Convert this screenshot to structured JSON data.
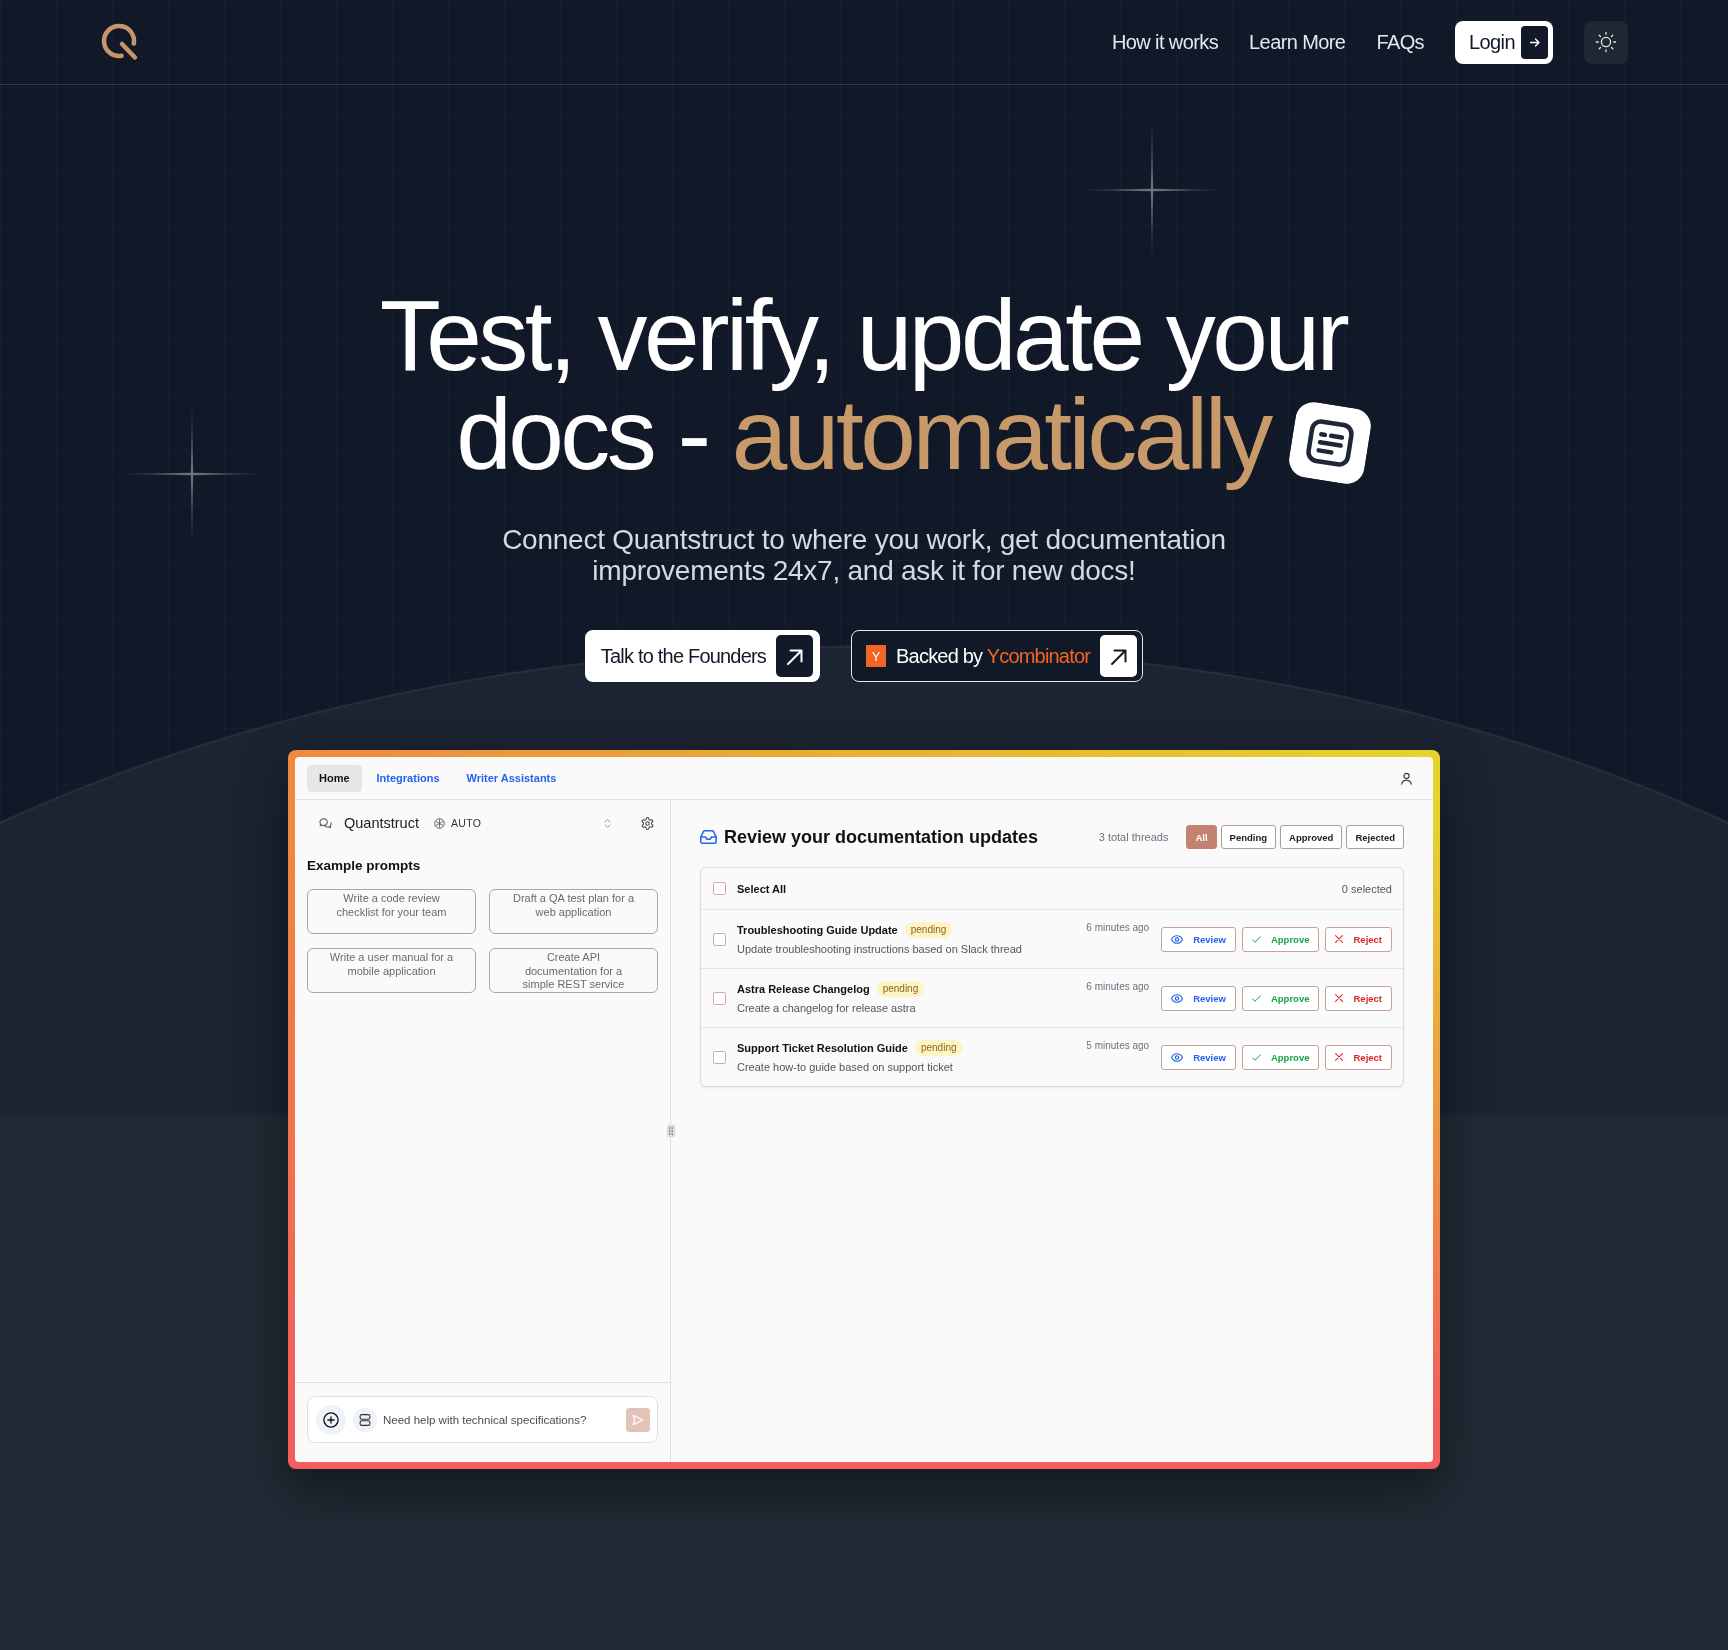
{
  "nav": {
    "links": [
      "How it works",
      "Learn More",
      "FAQs"
    ],
    "login": "Login"
  },
  "hero": {
    "title_lines": [
      {
        "text": "Test, verify, update your"
      },
      {
        "text": "docs -",
        "highlight": "automatically"
      }
    ],
    "subtitle": "Connect Quantstruct to where you work, get documentation improvements 24x7, and ask it for new docs!",
    "buttons": [
      {
        "kind": "light",
        "label": "Talk to the Founders"
      },
      {
        "kind": "dark",
        "badge": "Y",
        "label": "Backed by",
        "highlight": "Ycombinator"
      }
    ]
  },
  "app": {
    "tabs": [
      {
        "label": "Home",
        "selected": true
      },
      {
        "label": "Integrations",
        "selected": false
      },
      {
        "label": "Writer Assistants",
        "selected": false
      }
    ],
    "assistant": {
      "name": "Quantstruct",
      "mode": "AUTO"
    },
    "prompts_title": "Example prompts",
    "prompts": [
      "Write a code review checklist for your team",
      "Draft a QA test plan for a web application",
      "Write a user manual for a mobile application",
      "Create API documentation for a simple REST service"
    ],
    "composer": {
      "placeholder": "Need help with technical specifications?",
      "send_disabled": true
    },
    "review": {
      "title": "Review your documentation updates",
      "count": "3 total threads",
      "filters": [
        {
          "label": "All",
          "selected": true
        },
        {
          "label": "Pending",
          "selected": false
        },
        {
          "label": "Approved",
          "selected": false
        },
        {
          "label": "Rejected",
          "selected": false
        }
      ],
      "select_all": {
        "label": "Select All",
        "checked": false
      },
      "selected_count": "0 selected",
      "threads": [
        {
          "title": "Troubleshooting Guide Update",
          "status": "pending",
          "description": "Update troubleshooting instructions based on Slack thread",
          "time": "6 minutes ago",
          "checked": false,
          "actions": [
            {
              "kind": "review",
              "label": "Review"
            },
            {
              "kind": "approve",
              "label": "Approve"
            },
            {
              "kind": "reject",
              "label": "Reject"
            }
          ]
        },
        {
          "title": "Astra Release Changelog",
          "status": "pending",
          "description": "Create a changelog for release astra",
          "time": "6 minutes ago",
          "checked": false,
          "actions": [
            {
              "kind": "review",
              "label": "Review"
            },
            {
              "kind": "approve",
              "label": "Approve"
            },
            {
              "kind": "reject",
              "label": "Reject"
            }
          ]
        },
        {
          "title": "Support Ticket Resolution Guide",
          "status": "pending",
          "description": "Create how-to guide based on support ticket",
          "time": "5 minutes ago",
          "checked": false,
          "actions": [
            {
              "kind": "review",
              "label": "Review"
            },
            {
              "kind": "approve",
              "label": "Approve"
            },
            {
              "kind": "reject",
              "label": "Reject"
            }
          ]
        }
      ]
    }
  }
}
